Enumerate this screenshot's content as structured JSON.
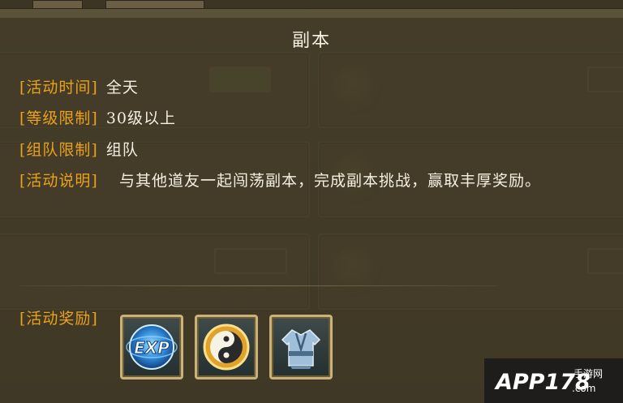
{
  "dialog": {
    "title": "副本",
    "rows": [
      {
        "label": "[活动时间]",
        "value": "全天"
      },
      {
        "label": "[等级限制]",
        "value": "30级以上"
      },
      {
        "label": "[组队限制]",
        "value": "组队"
      }
    ],
    "description": {
      "label": "[活动说明]",
      "value": "与其他道友一起闯荡副本，完成副本挑战，赢取丰厚奖励。"
    },
    "reward": {
      "label": "[活动奖励]",
      "items": [
        {
          "name": "exp-icon",
          "text": "EXP"
        },
        {
          "name": "taiji-coin-icon"
        },
        {
          "name": "robe-icon"
        }
      ]
    }
  },
  "watermark": {
    "text": "APP178",
    "sub": "手游网",
    "domain": ".com"
  },
  "colors": {
    "label": "#e9a21c",
    "value": "#f4efe2",
    "slot_border": "#c9b27a"
  }
}
